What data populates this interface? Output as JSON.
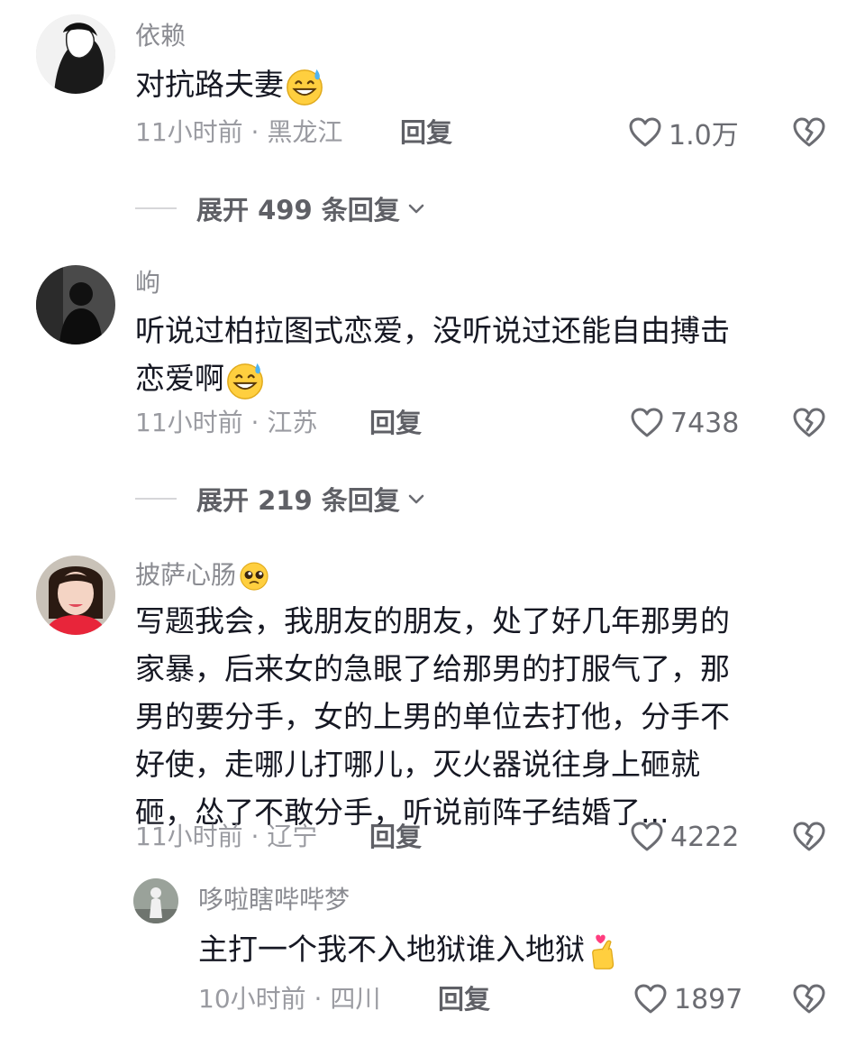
{
  "comments": [
    {
      "username": "依赖",
      "text": "对抗路夫妻",
      "time_location": "11小时前 · 黑龙江",
      "reply_label": "回复",
      "likes": "1.0万",
      "expand_label": "展开 499 条回复"
    },
    {
      "username": "岣",
      "text_line1": "听说过柏拉图式恋爱，没听说过还能自由搏击",
      "text_line2": "恋爱啊",
      "time_location": "11小时前 · 江苏",
      "reply_label": "回复",
      "likes": "7438",
      "expand_label": "展开 219 条回复"
    },
    {
      "username": "披萨心肠",
      "lines": [
        "写题我会，我朋友的朋友，处了好几年那男的",
        "家暴，后来女的急眼了给那男的打服气了，那",
        "男的要分手，女的上男的单位去打他，分手不",
        "好使，走哪儿打哪儿，灭火器说往身上砸就",
        "砸，怂了不敢分手，听说前阵子结婚了..."
      ],
      "time_location": "11小时前 · 辽宁",
      "reply_label": "回复",
      "likes": "4222"
    }
  ],
  "reply": {
    "username": "哆啦瞎哔哔梦",
    "text": "主打一个我不入地狱谁入地狱",
    "time_location": "10小时前 · 四川",
    "reply_label": "回复",
    "likes": "1897"
  },
  "icons": {
    "like": "heart-outline-icon",
    "dislike": "broken-heart-icon",
    "expand": "chevron-down-icon",
    "emoji_sweat_smile": "sweat-smile-emoji",
    "emoji_pleading": "pleading-face-emoji",
    "emoji_finger_heart": "finger-heart-emoji"
  },
  "colors": {
    "text_primary": "#161823",
    "text_secondary": "#8a8b91",
    "meta": "#9a9ba1",
    "icon": "#6b6c72"
  }
}
